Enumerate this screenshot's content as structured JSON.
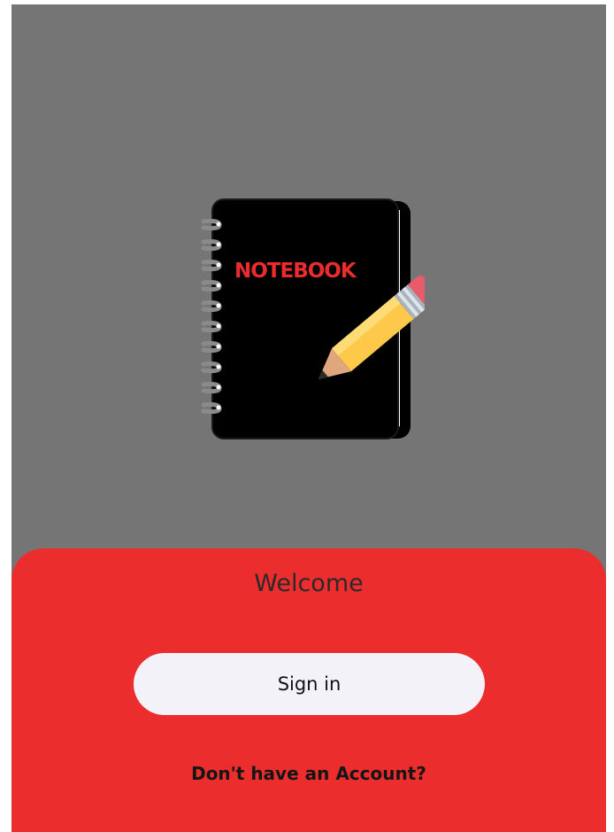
{
  "logo": {
    "icon": "notebook-pencil-icon",
    "title": "NOTEBOOK"
  },
  "sheet": {
    "welcome": "Welcome",
    "signin_label": "Sign in",
    "account_link": "Don't have an Account?"
  },
  "colors": {
    "background": "#757575",
    "sheet": "#eb2d2d",
    "button": "#f3f2f8",
    "notebook_title": "#ea2c2c",
    "pencil_body": "#fec84a"
  }
}
